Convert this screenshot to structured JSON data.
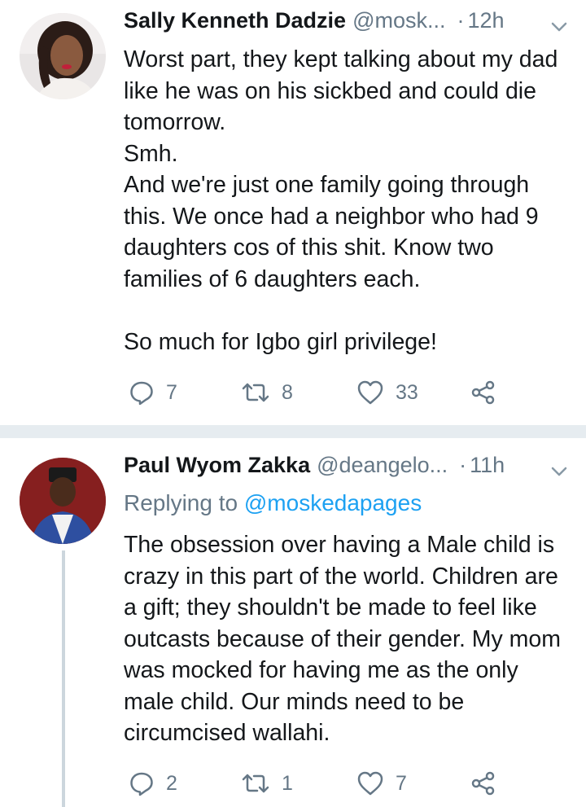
{
  "tweets": [
    {
      "name": "Sally Kenneth Dadzie",
      "handle": "@mosk...",
      "dot": "·",
      "time": "12h",
      "body": "Worst part, they kept talking about my dad like he was on his sickbed and could die tomorrow.\nSmh.\nAnd we're just one family going through this. We once had a neighbor who had 9 daughters cos of this shit. Know two families of 6 daughters each.\n\nSo much for Igbo girl privilege!",
      "replies": "7",
      "retweets": "8",
      "likes": "33"
    },
    {
      "name": "Paul Wyom Zakka",
      "handle": "@deangelo...",
      "dot": "·",
      "time": "11h",
      "replying_prefix": "Replying to",
      "replying_to": "@moskedapages",
      "body": "The obsession over having a Male child is crazy in this part of the world. Children are a gift; they shouldn't be made to feel like outcasts because of their gender. My mom was mocked for having me as the only male child. Our minds need to be circumcised wallahi.",
      "replies": "2",
      "retweets": "1",
      "likes": "7"
    }
  ],
  "colors": {
    "text": "#14171a",
    "secondary": "#657786",
    "link": "#1da1f2",
    "divider": "#e6ecf0",
    "thread_line": "#ccd6dd"
  },
  "icons": [
    "reply-icon",
    "retweet-icon",
    "like-icon",
    "share-icon",
    "chevron-down-icon"
  ]
}
